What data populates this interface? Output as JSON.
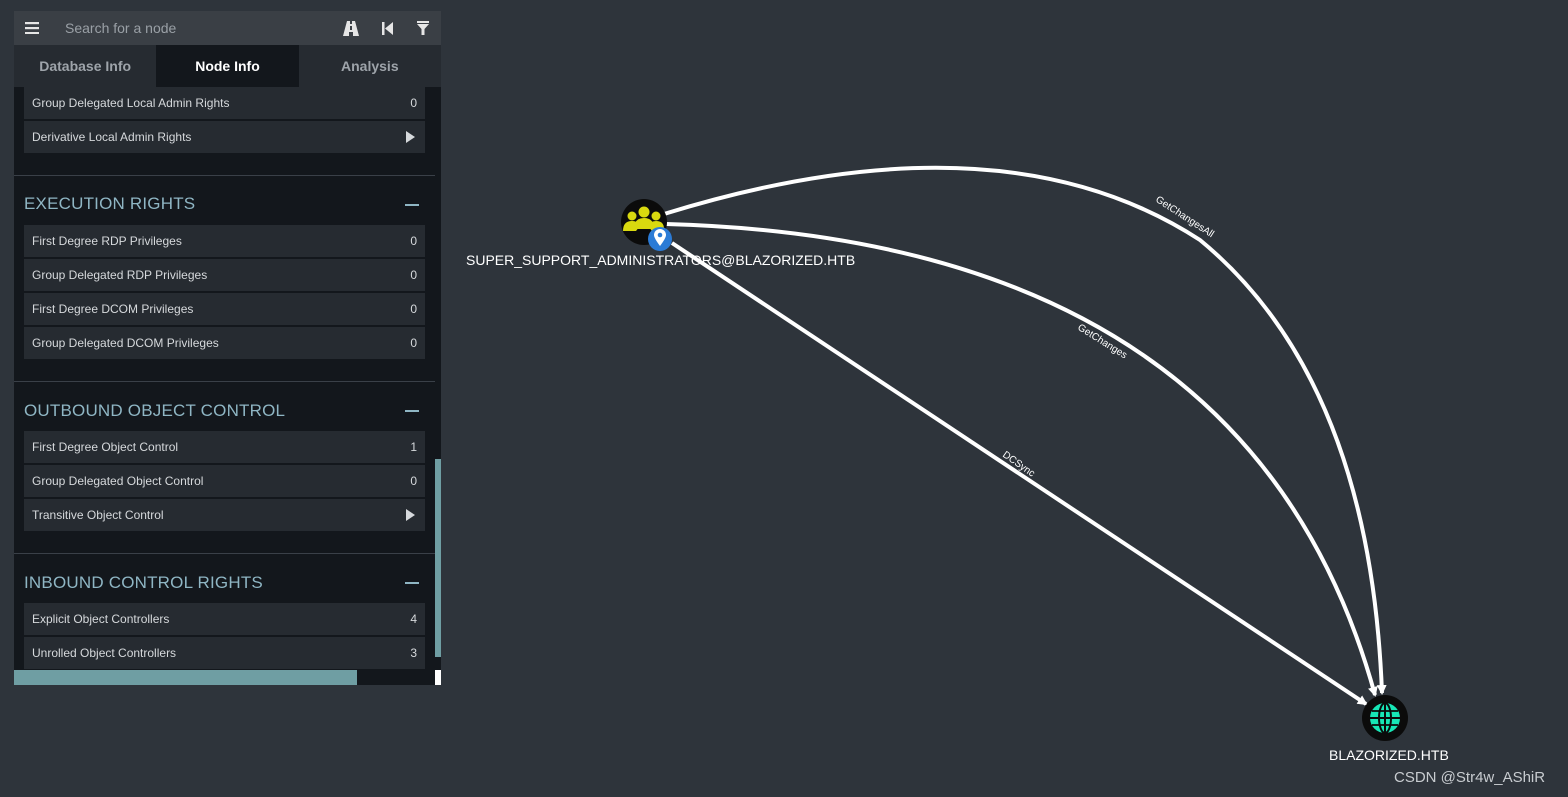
{
  "search": {
    "placeholder": "Search for a node"
  },
  "toolbar": {
    "menu_icon": "hamburger-icon",
    "pathfinding_icon": "road-icon",
    "back_icon": "skip-back-icon",
    "filter_icon": "filter-icon"
  },
  "tabs": [
    {
      "label": "Database Info",
      "active": false
    },
    {
      "label": "Node Info",
      "active": true
    },
    {
      "label": "Analysis",
      "active": false
    }
  ],
  "local_admin": {
    "rows": [
      {
        "label": "Group Delegated Local Admin Rights",
        "value": "0"
      },
      {
        "label": "Derivative Local Admin Rights",
        "value": ""
      }
    ]
  },
  "execution_rights": {
    "title": "EXECUTION RIGHTS",
    "rows": [
      {
        "label": "First Degree RDP Privileges",
        "value": "0"
      },
      {
        "label": "Group Delegated RDP Privileges",
        "value": "0"
      },
      {
        "label": "First Degree DCOM Privileges",
        "value": "0"
      },
      {
        "label": "Group Delegated DCOM Privileges",
        "value": "0"
      }
    ]
  },
  "outbound_control": {
    "title": "OUTBOUND OBJECT CONTROL",
    "rows": [
      {
        "label": "First Degree Object Control",
        "value": "1"
      },
      {
        "label": "Group Delegated Object Control",
        "value": "0"
      },
      {
        "label": "Transitive Object Control",
        "value": ""
      }
    ]
  },
  "inbound_control": {
    "title": "INBOUND CONTROL RIGHTS",
    "rows": [
      {
        "label": "Explicit Object Controllers",
        "value": "4"
      },
      {
        "label": "Unrolled Object Controllers",
        "value": "3"
      }
    ]
  },
  "graph": {
    "nodes": {
      "group": {
        "label": "SUPER_SUPPORT_ADMINISTRATORS@BLAZORIZED.HTB",
        "icon": "users-icon",
        "color": "#d9d90f"
      },
      "domain": {
        "label": "BLAZORIZED.HTB",
        "icon": "globe-icon",
        "color": "#17e6b6"
      }
    },
    "edges": {
      "getchangesall": "GetChangesAll",
      "getchanges": "GetChanges",
      "dcsync": "DCSync"
    }
  },
  "watermark": "CSDN @Str4w_AShiR"
}
